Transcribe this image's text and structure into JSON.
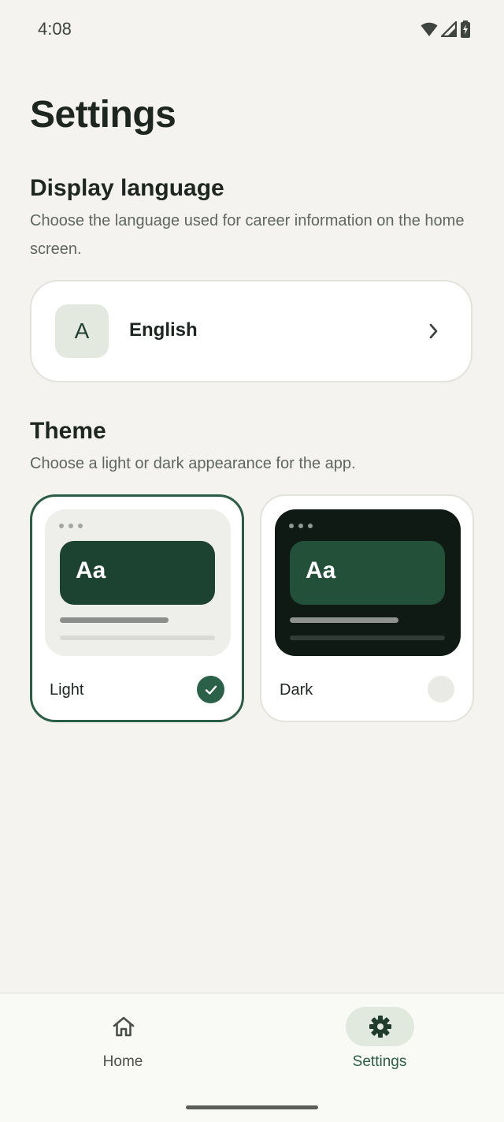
{
  "status_bar": {
    "time": "4:08",
    "icons": [
      "wifi-icon",
      "cellular-signal-icon",
      "battery-charging-icon"
    ]
  },
  "page": {
    "title": "Settings"
  },
  "display_language": {
    "title": "Display language",
    "description": "Choose the language used for career information on the home screen.",
    "avatar_letter": "A",
    "selected_language": "English"
  },
  "theme": {
    "title": "Theme",
    "description": "Choose a light or dark appearance for the app.",
    "options": [
      {
        "label": "Light",
        "preview_text": "Aa",
        "selected": true
      },
      {
        "label": "Dark",
        "preview_text": "Aa",
        "selected": false
      }
    ]
  },
  "bottom_nav": {
    "items": [
      {
        "label": "Home",
        "icon": "home-icon",
        "active": false
      },
      {
        "label": "Settings",
        "icon": "gear-icon",
        "active": true
      }
    ]
  },
  "colors": {
    "accent": "#2b5c45",
    "background": "#f4f3ef",
    "dark_preview": "#0f1a15"
  }
}
